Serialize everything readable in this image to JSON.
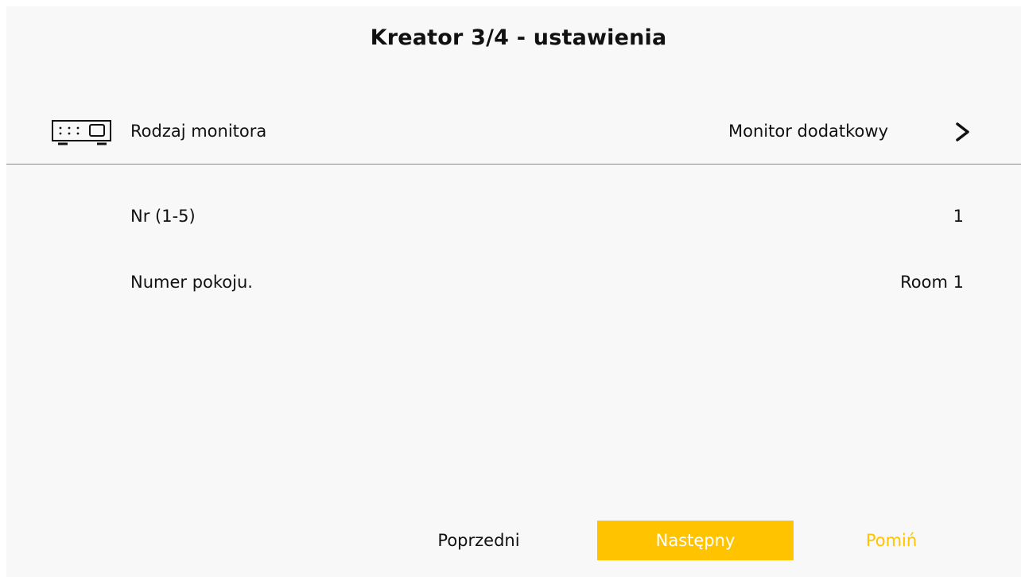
{
  "header": {
    "title": "Kreator 3/4 - ustawienia"
  },
  "settings": {
    "monitor_type": {
      "icon": "monitor-device-icon",
      "label": "Rodzaj monitora",
      "value": "Monitor dodatkowy",
      "chevron": "chevron-right-icon"
    },
    "number": {
      "label": "Nr (1-5)",
      "value": "1"
    },
    "room_number": {
      "label": "Numer pokoju.",
      "value": "Room 1"
    }
  },
  "footer": {
    "previous_label": "Poprzedni",
    "next_label": "Następny",
    "skip_label": "Pomiń"
  },
  "colors": {
    "accent": "#ffc300",
    "background": "#f8f8f8",
    "divider": "#8a8a8a"
  }
}
